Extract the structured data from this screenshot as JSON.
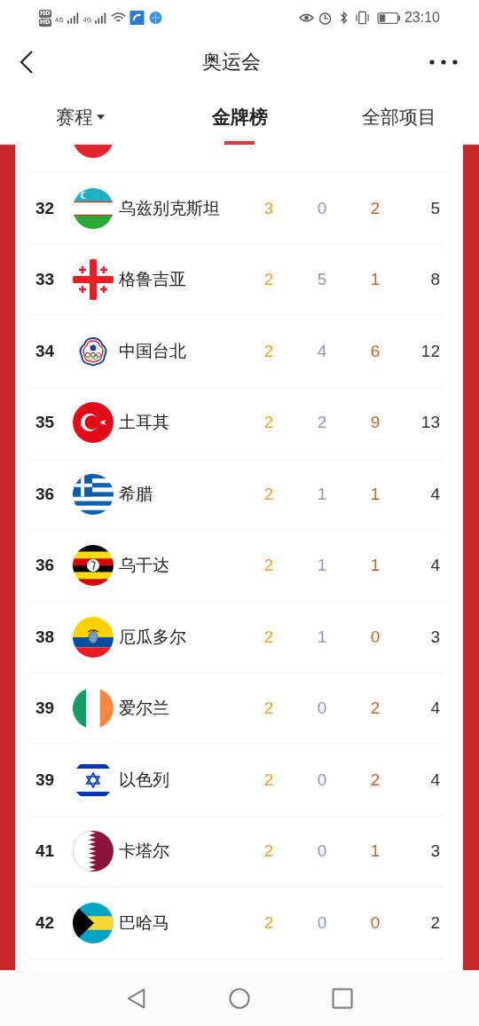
{
  "status_bar": {
    "sim_labels": [
      "HD",
      "HD"
    ],
    "network_labels": [
      "4G",
      "4G"
    ],
    "time": "23:10"
  },
  "header": {
    "title": "奥运会"
  },
  "tabs": [
    {
      "label": "赛程",
      "selected": false,
      "dropdown": true
    },
    {
      "label": "金牌榜",
      "selected": true,
      "dropdown": false
    },
    {
      "label": "全部项目",
      "selected": false,
      "dropdown": false
    }
  ],
  "cut_row": {
    "kind": "red"
  },
  "rows": [
    {
      "rank": "32",
      "kind": "uzbekistan",
      "country": "乌兹别克斯坦",
      "gold": "3",
      "silver": "0",
      "bronze": "2",
      "total": "5"
    },
    {
      "rank": "33",
      "kind": "georgia",
      "country": "格鲁吉亚",
      "gold": "2",
      "silver": "5",
      "bronze": "1",
      "total": "8"
    },
    {
      "rank": "34",
      "kind": "taipei",
      "country": "中国台北",
      "gold": "2",
      "silver": "4",
      "bronze": "6",
      "total": "12"
    },
    {
      "rank": "35",
      "kind": "turkey",
      "country": "土耳其",
      "gold": "2",
      "silver": "2",
      "bronze": "9",
      "total": "13"
    },
    {
      "rank": "36",
      "kind": "greece",
      "country": "希腊",
      "gold": "2",
      "silver": "1",
      "bronze": "1",
      "total": "4"
    },
    {
      "rank": "36",
      "kind": "uganda",
      "country": "乌干达",
      "gold": "2",
      "silver": "1",
      "bronze": "1",
      "total": "4"
    },
    {
      "rank": "38",
      "kind": "ecuador",
      "country": "厄瓜多尔",
      "gold": "2",
      "silver": "1",
      "bronze": "0",
      "total": "3"
    },
    {
      "rank": "39",
      "kind": "ireland",
      "country": "爱尔兰",
      "gold": "2",
      "silver": "0",
      "bronze": "2",
      "total": "4"
    },
    {
      "rank": "39",
      "kind": "israel",
      "country": "以色列",
      "gold": "2",
      "silver": "0",
      "bronze": "2",
      "total": "4"
    },
    {
      "rank": "41",
      "kind": "qatar",
      "country": "卡塔尔",
      "gold": "2",
      "silver": "0",
      "bronze": "1",
      "total": "3"
    },
    {
      "rank": "42",
      "kind": "bahamas",
      "country": "巴哈马",
      "gold": "2",
      "silver": "0",
      "bronze": "0",
      "total": "2"
    }
  ]
}
